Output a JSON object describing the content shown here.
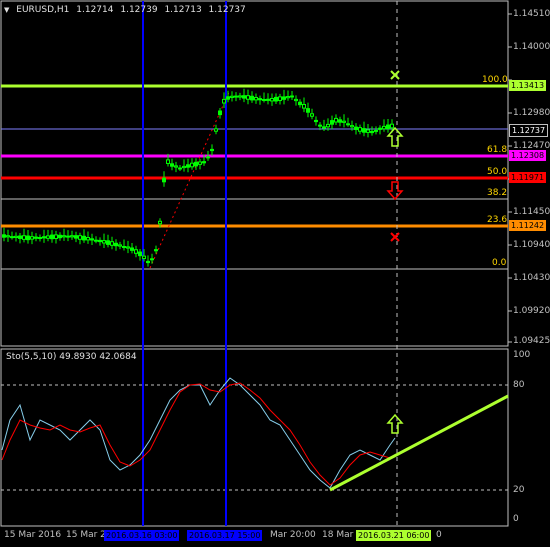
{
  "header": {
    "symbol": "EURUSD,H1",
    "open": "1.12714",
    "high": "1.12739",
    "low": "1.12713",
    "close": "1.12737"
  },
  "price_axis": {
    "ticks": [
      "1.14510",
      "1.14000",
      "1.13490",
      "1.12980",
      "1.12470",
      "1.11960",
      "1.11450",
      "1.10940",
      "1.10430",
      "1.09920",
      "1.09425"
    ]
  },
  "fib_levels": [
    {
      "label": "100.0",
      "value": "1.13413",
      "color": "#adff2f"
    },
    {
      "label": "61.8",
      "value": "1.12308",
      "color": "#ff00ff"
    },
    {
      "label": "50.0",
      "value": "1.11971",
      "color": "#ff0000"
    },
    {
      "label": "38.2",
      "value": "",
      "color": "#c0c0c0"
    },
    {
      "label": "23.6",
      "value": "1.11242",
      "color": "#ff8c00"
    },
    {
      "label": "0.0",
      "value": "",
      "color": "#c0c0c0"
    }
  ],
  "current_price": "1.12737",
  "stochastic": {
    "label": "Sto(5,5,10) 49.8930 42.0684",
    "axis_ticks": [
      "100",
      "80",
      "20",
      "0"
    ]
  },
  "time_axis": {
    "ticks": [
      "15 Mar 2016",
      "15 Mar 2",
      "2016.03.16 03:00",
      "2016.03.17 15:00",
      "Mar 20:00",
      "18 Mar",
      "2016.03.21 06:00",
      "0"
    ]
  },
  "colors": {
    "bull_candle": "#00ff00",
    "main_line": "#87ceeb",
    "signal_line": "#ff0000",
    "trend_line": "#adff2f",
    "vline": "#0000ff"
  },
  "icons": [
    "buy-arrow-icon",
    "sell-arrow-icon",
    "buy-cross-icon",
    "sell-cross-icon"
  ]
}
